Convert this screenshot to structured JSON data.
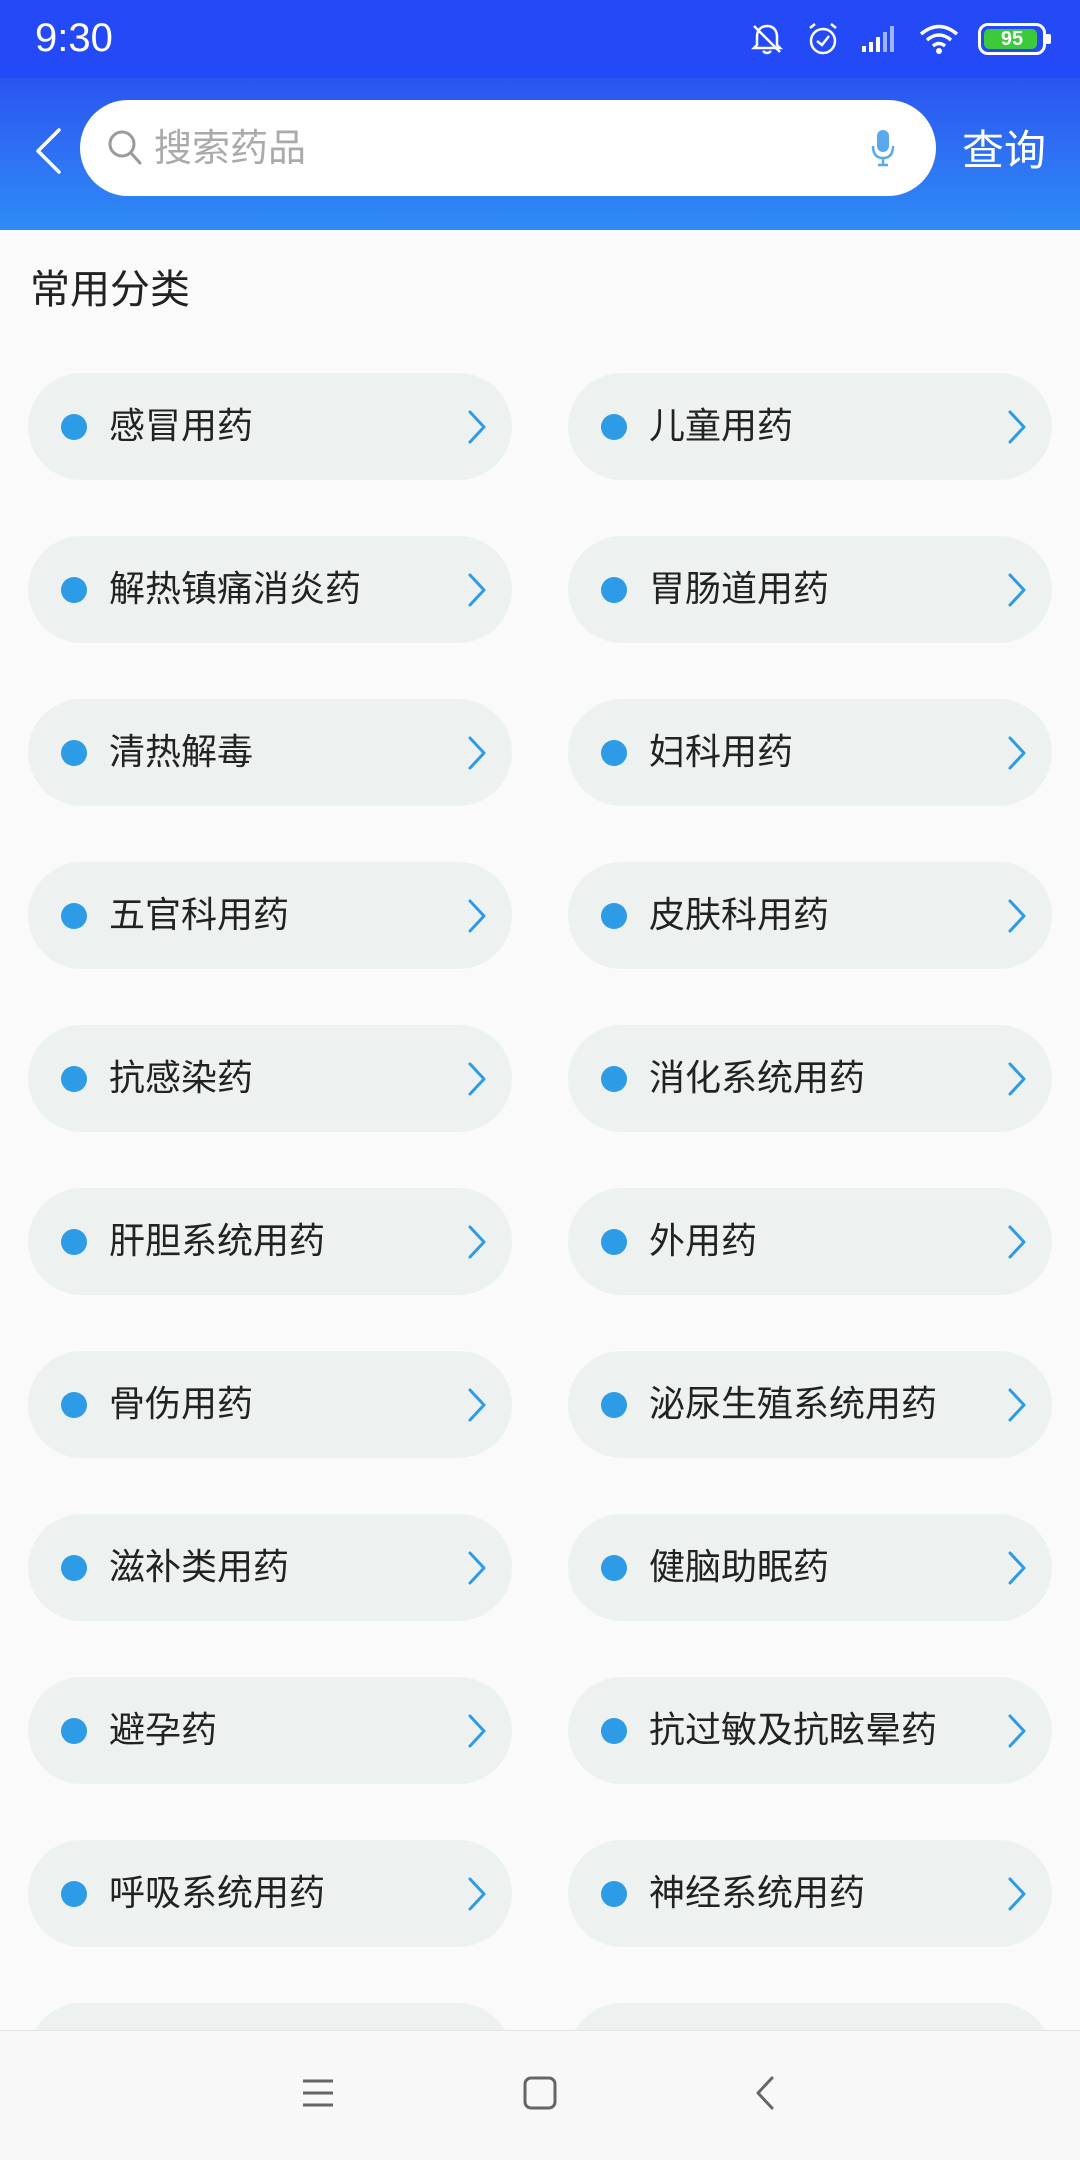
{
  "status_bar": {
    "time": "9:30",
    "battery_level": "95",
    "icons": [
      "mute-bell-icon",
      "alarm-icon",
      "signal-icon",
      "wifi-icon",
      "battery-icon"
    ]
  },
  "header": {
    "search_placeholder": "搜索药品",
    "query_label": "查询"
  },
  "section": {
    "title": "常用分类"
  },
  "categories": [
    "感冒用药",
    "儿童用药",
    "解热镇痛消炎药",
    "胃肠道用药",
    "清热解毒",
    "妇科用药",
    "五官科用药",
    "皮肤科用药",
    "抗感染药",
    "消化系统用药",
    "肝胆系统用药",
    "外用药",
    "骨伤用药",
    "泌尿生殖系统用药",
    "滋补类用药",
    "健脑助眠药",
    "避孕药",
    "抗过敏及抗眩晕药",
    "呼吸系统用药",
    "神经系统用药"
  ],
  "colors": {
    "status_bar": "#2449f6",
    "header_accent": "#2f8cf6",
    "bullet": "#2d9be6",
    "pill_bg": "#edf2f0",
    "battery": "#3cc93c"
  },
  "nav": {
    "icons": [
      "menu-icon",
      "home-icon",
      "back-icon"
    ]
  }
}
